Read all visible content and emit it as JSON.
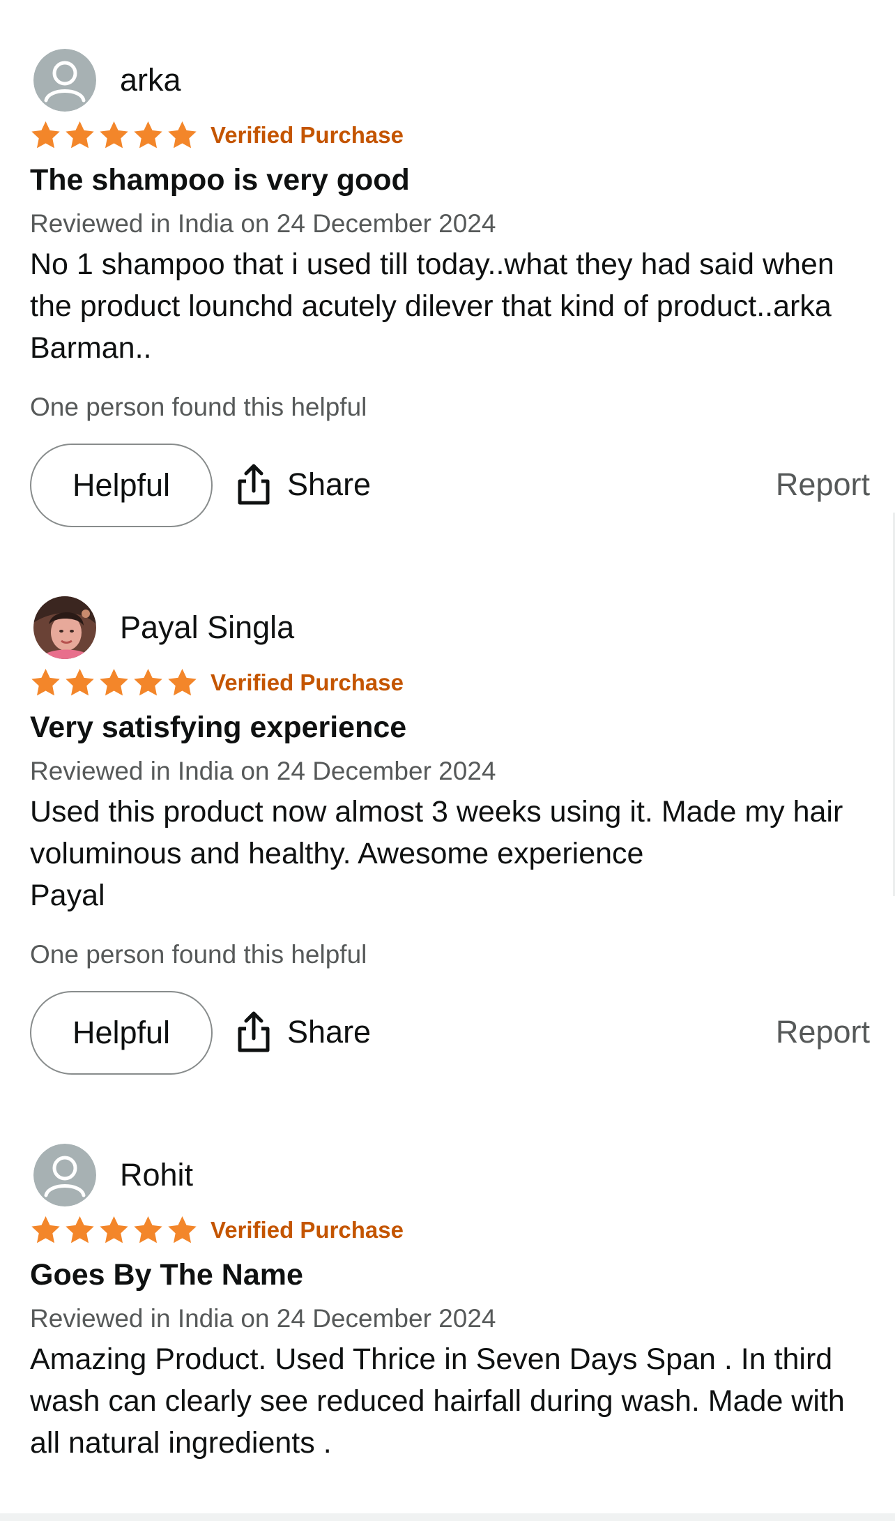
{
  "reviews": [
    {
      "reviewer": "arka",
      "avatar": "default-profile-icon",
      "rating": 5,
      "verified_label": "Verified Purchase",
      "title": "The shampoo is very good",
      "date_line": "Reviewed in India on 24 December 2024",
      "body": "No 1 shampoo that i used till today..what they had said when the product lounchd acutely dilever that kind of product..arka Barman..",
      "helpful_count_text": "One person found this helpful",
      "helpful_label": "Helpful",
      "share_label": "Share",
      "report_label": "Report"
    },
    {
      "reviewer": "Payal Singla",
      "avatar": "user-photo",
      "rating": 5,
      "verified_label": "Verified Purchase",
      "title": "Very satisfying experience",
      "date_line": "Reviewed in India on 24 December 2024",
      "body": "Used this product now almost 3 weeks using it. Made my hair voluminous and healthy. Awesome experience\nPayal",
      "helpful_count_text": "One person found this helpful",
      "helpful_label": "Helpful",
      "share_label": "Share",
      "report_label": "Report"
    },
    {
      "reviewer": "Rohit",
      "avatar": "default-profile-icon",
      "rating": 5,
      "verified_label": "Verified Purchase",
      "title": "Goes By The Name",
      "date_line": "Reviewed in India on 24 December 2024",
      "body": "Amazing Product. Used Thrice in Seven Days Span . In third wash can clearly see reduced hairfall during wash. Made with all natural ingredients ."
    }
  ],
  "colors": {
    "star": "#f3862a",
    "verified": "#c45500",
    "text_primary": "#0f1111",
    "text_secondary": "#565959",
    "avatar_bg": "#a7b1b3"
  }
}
